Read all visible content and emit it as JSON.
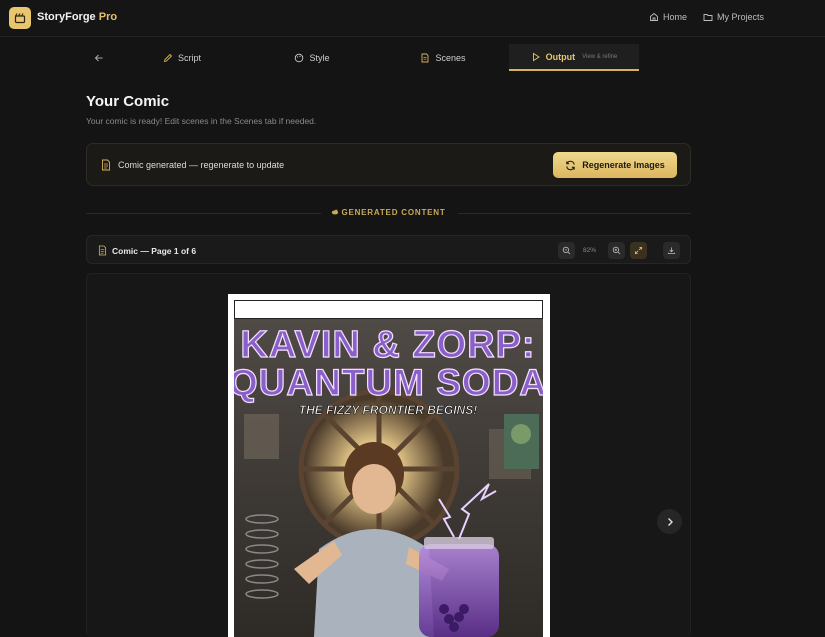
{
  "app": {
    "name": "StoryForge",
    "name_suffix": "Pro",
    "nav": [
      {
        "label": "Home",
        "icon": "home-icon"
      },
      {
        "label": "My Projects",
        "icon": "folder-icon"
      }
    ]
  },
  "tabs": [
    {
      "label": "Script",
      "icon": "pen-icon"
    },
    {
      "label": "Style",
      "icon": "palette-icon"
    },
    {
      "label": "Scenes",
      "icon": "document-icon"
    },
    {
      "label": "Output",
      "sub": "View & refine",
      "icon": "play-icon",
      "active": true
    }
  ],
  "page": {
    "title": "Your Comic",
    "subtitle": "Your comic is ready! Edit scenes in the Scenes tab if needed."
  },
  "status": {
    "message": "Comic generated — regenerate to update",
    "button": "Regenerate Images"
  },
  "section": {
    "label": "GENERATED CONTENT"
  },
  "viewer": {
    "page_label": "Comic — Page 1 of 6",
    "zoom": "82%"
  },
  "comic": {
    "title_line1": "KAVIN & ZORP:",
    "title_line2": "QUANTUM SODA",
    "tagline": "THE FIZZY FRONTIER BEGINS!"
  },
  "colors": {
    "accent": "#e2c06a",
    "background": "#141414",
    "title_fill": "#8b5fc9"
  }
}
